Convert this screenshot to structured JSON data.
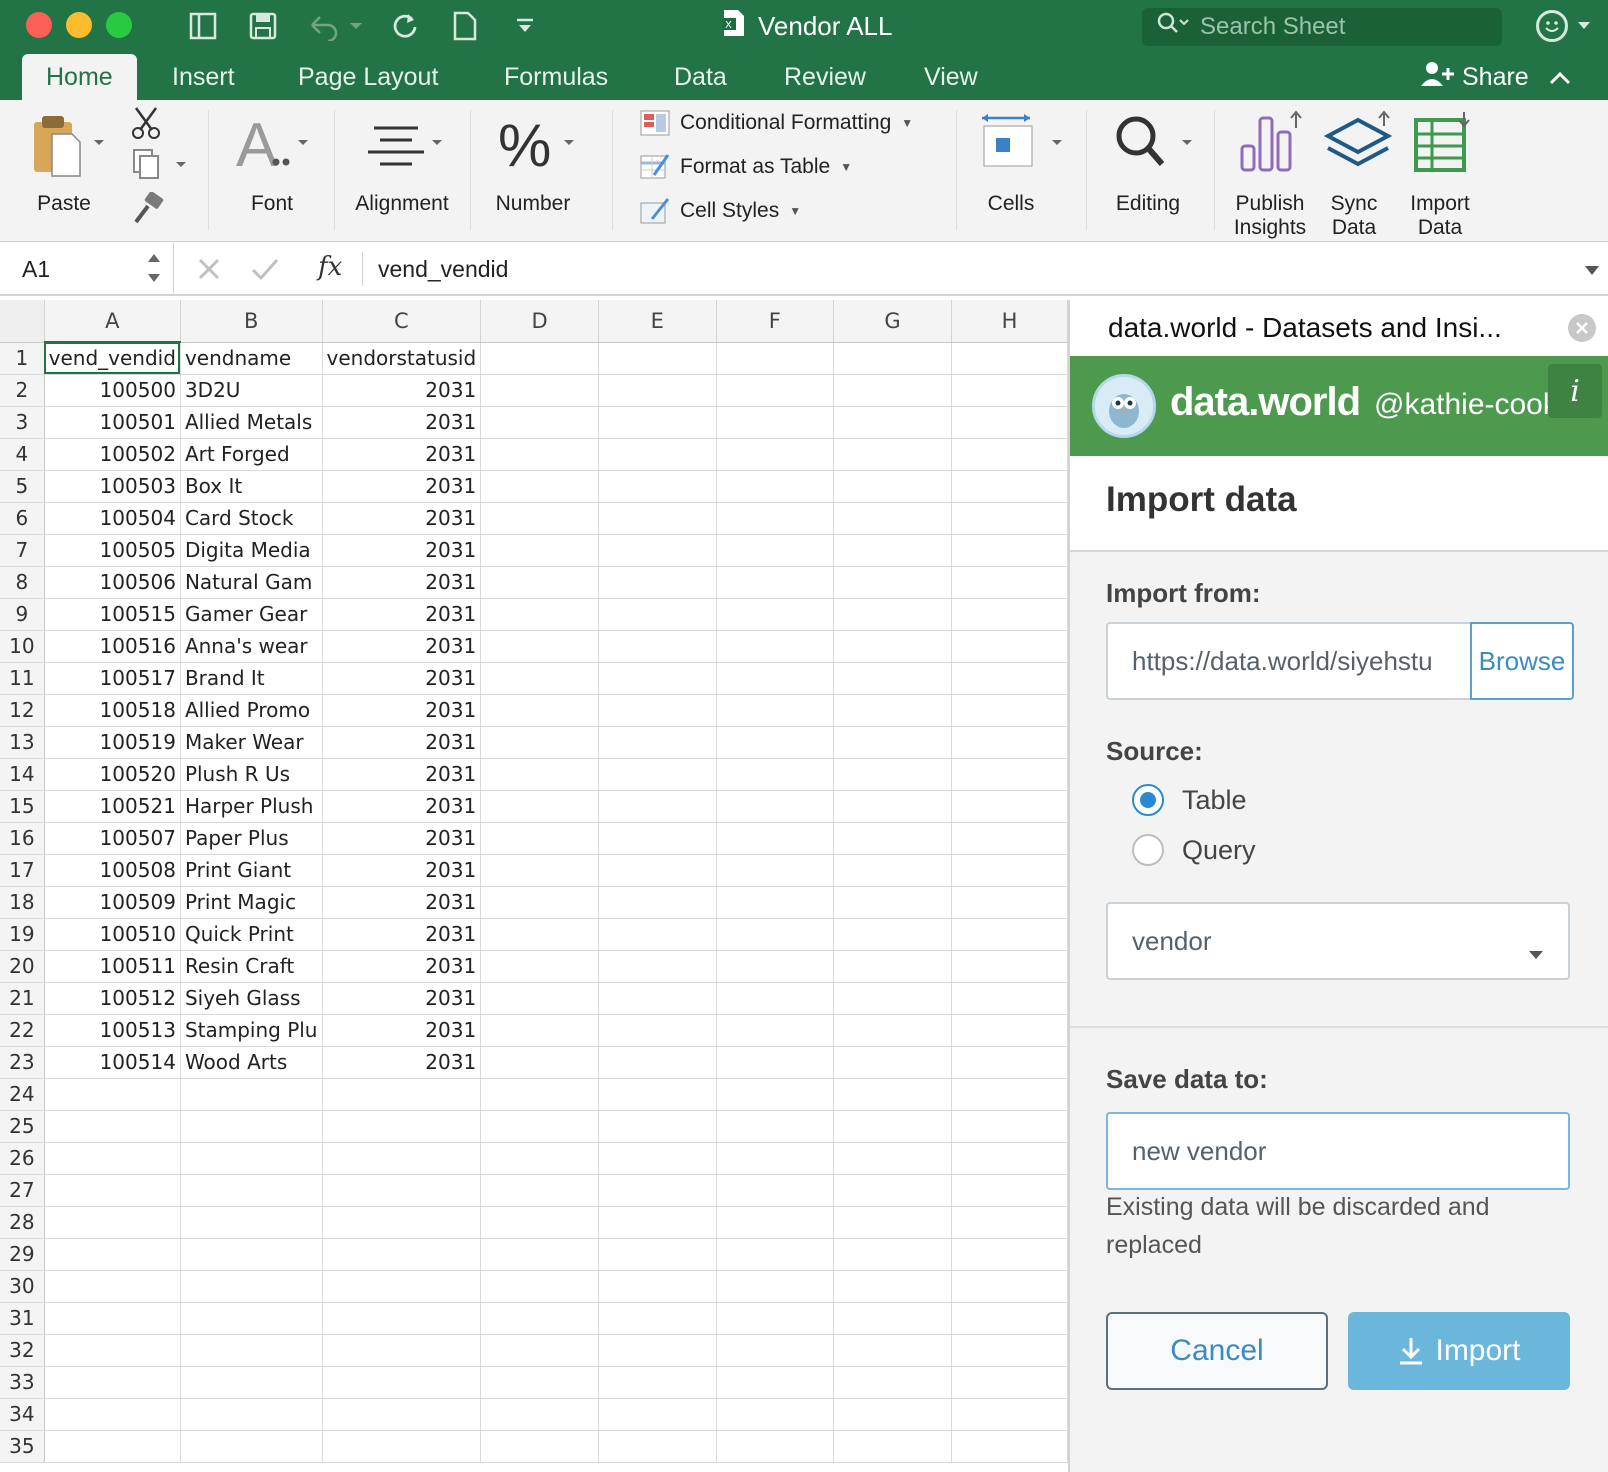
{
  "window": {
    "title": "Vendor ALL",
    "search_placeholder": "Search Sheet"
  },
  "tabs": [
    "Home",
    "Insert",
    "Page Layout",
    "Formulas",
    "Data",
    "Review",
    "View"
  ],
  "share_label": "Share",
  "ribbon": {
    "paste": "Paste",
    "font": "Font",
    "alignment": "Alignment",
    "number": "Number",
    "conditional_formatting": "Conditional Formatting",
    "format_as_table": "Format as Table",
    "cell_styles": "Cell Styles",
    "cells": "Cells",
    "editing": "Editing",
    "publish_insights_1": "Publish",
    "publish_insights_2": "Insights",
    "sync_data_1": "Sync",
    "sync_data_2": "Data",
    "import_data_1": "Import",
    "import_data_2": "Data"
  },
  "formula_bar": {
    "cell_ref": "A1",
    "fx": "fx",
    "value": "vend_vendid"
  },
  "sheet": {
    "columns": [
      "A",
      "B",
      "C",
      "D",
      "E",
      "F",
      "G",
      "H"
    ],
    "header_row": [
      "vend_vendid",
      "vendname",
      "vendorstatusid"
    ],
    "rows": [
      [
        "100500",
        "3D2U",
        "2031"
      ],
      [
        "100501",
        "Allied Metals",
        "2031"
      ],
      [
        "100502",
        "Art Forged",
        "2031"
      ],
      [
        "100503",
        "Box It",
        "2031"
      ],
      [
        "100504",
        "Card Stock",
        "2031"
      ],
      [
        "100505",
        "Digita Media",
        "2031"
      ],
      [
        "100506",
        "Natural Gam",
        "2031"
      ],
      [
        "100515",
        "Gamer Gear",
        "2031"
      ],
      [
        "100516",
        "Anna's wear",
        "2031"
      ],
      [
        "100517",
        "Brand It",
        "2031"
      ],
      [
        "100518",
        "Allied Promo",
        "2031"
      ],
      [
        "100519",
        "Maker Wear",
        "2031"
      ],
      [
        "100520",
        "Plush R Us",
        "2031"
      ],
      [
        "100521",
        "Harper Plush",
        "2031"
      ],
      [
        "100507",
        "Paper Plus",
        "2031"
      ],
      [
        "100508",
        "Print Giant",
        "2031"
      ],
      [
        "100509",
        "Print Magic",
        "2031"
      ],
      [
        "100510",
        "Quick Print",
        "2031"
      ],
      [
        "100511",
        "Resin Craft",
        "2031"
      ],
      [
        "100512",
        "Siyeh Glass",
        "2031"
      ],
      [
        "100513",
        "Stamping Plu",
        "2031"
      ],
      [
        "100514",
        "Wood Arts",
        "2031"
      ]
    ],
    "row_numbers": [
      "1",
      "2",
      "3",
      "4",
      "5",
      "6",
      "7",
      "8",
      "9",
      "10",
      "11",
      "12",
      "13",
      "14",
      "15",
      "16",
      "17",
      "18",
      "19",
      "20",
      "21",
      "22",
      "23",
      "24",
      "25",
      "26",
      "27",
      "28",
      "29",
      "30",
      "31",
      "32",
      "33",
      "34",
      "35"
    ]
  },
  "pane": {
    "header": "data.world - Datasets and Insi...",
    "brand": "data.world",
    "user": "@kathie-cook",
    "title": "Import data",
    "import_from_label": "Import from:",
    "import_from_value": "https://data.world/siyehstu",
    "browse": "Browse",
    "source_label": "Source:",
    "source_options": [
      "Table",
      "Query"
    ],
    "source_selected": "Table",
    "table_select": "vendor",
    "save_to_label": "Save data to:",
    "save_to_value": "new vendor",
    "hint": "Existing data will be discarded and replaced",
    "cancel": "Cancel",
    "import": "Import"
  },
  "colors": {
    "excel_green": "#227447",
    "dw_green": "#4d9a4f",
    "accent_blue": "#3a8bbf",
    "import_button": "#6bb7dc"
  }
}
